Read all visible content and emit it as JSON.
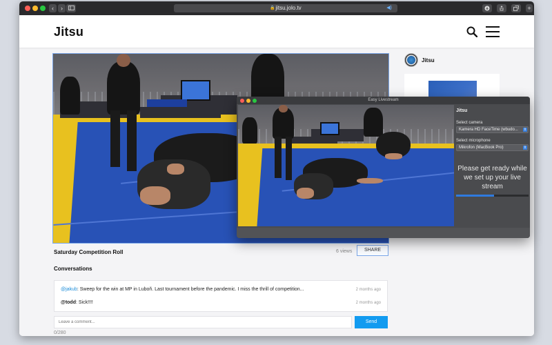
{
  "browser": {
    "url": "jitsu.jolo.tv",
    "nav_back": "‹",
    "nav_forward": "›",
    "sidebar_icon": "sidebar-icon",
    "download_icon": "download-icon",
    "share_icon": "share-icon",
    "tabs_icon": "tabs-icon",
    "plus_icon": "plus-icon"
  },
  "site": {
    "logo": "Jitsu"
  },
  "video": {
    "title": "Saturday Competition Roll",
    "views": "6 views",
    "share_label": "SHARE"
  },
  "conversations": {
    "title": "Conversations",
    "comments": [
      {
        "user": "@jakub",
        "text": ": Sweep for the win at MP in Luboň. Last tournament before the pandemic. I miss the thrill of competition...",
        "time": "2 months ago"
      },
      {
        "user": "@todd",
        "text": ": Sick!!!!",
        "time": "2 months ago"
      }
    ],
    "input_placeholder": "Leave a comment...",
    "send_label": "Send",
    "char_counter": "0/280"
  },
  "sidebar": {
    "channel_name": "Jitsu"
  },
  "livestream_panel": {
    "window_title": "Easy Livestream",
    "channel": "Jitsu",
    "camera_label": "Select camera",
    "camera_value": "Kamera HD FaceTime (wbudo...",
    "mic_label": "Select microphone",
    "mic_value": "Mikrofon (MacBook Pro)",
    "status": "Please get ready while we set up your live stream",
    "progress": 0.52
  },
  "colors": {
    "accent": "#129bf0",
    "link": "#1a8bd8",
    "progress": "#2f7bdf",
    "traffic_red": "#ff5f57",
    "traffic_yellow": "#febc2e",
    "traffic_green": "#28c840"
  }
}
